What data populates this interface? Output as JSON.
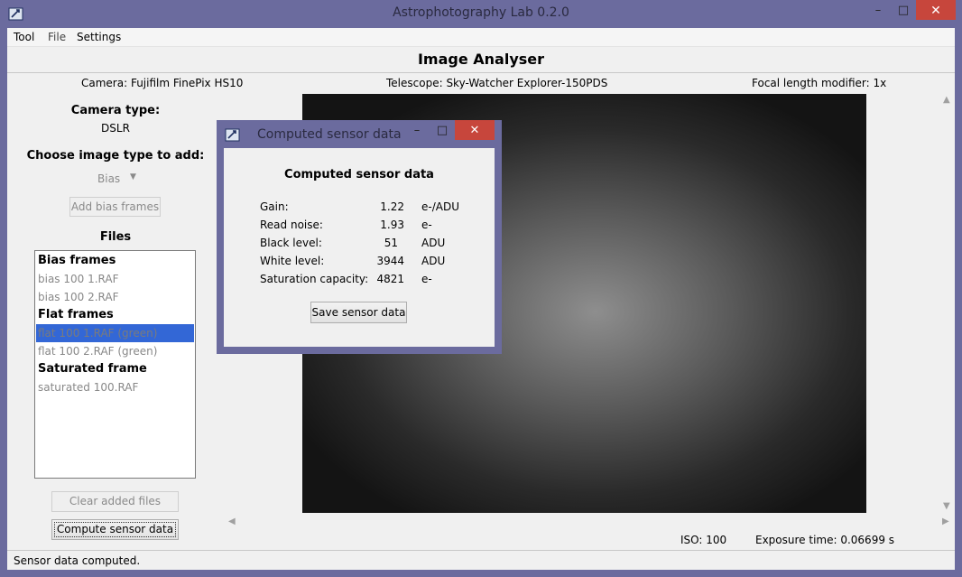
{
  "window": {
    "title": "Astrophotography Lab 0.2.0",
    "minimize": "–",
    "maximize": "□",
    "close": "✕"
  },
  "menu": [
    "Tool",
    "File",
    "Settings"
  ],
  "heading": "Image Analyser",
  "info": {
    "camera": "Camera: Fujifilm FinePix HS10",
    "telescope": "Telescope: Sky-Watcher Explorer-150PDS",
    "focal": "Focal length modifier: 1x"
  },
  "left": {
    "camera_type_label": "Camera type:",
    "camera_type_value": "DSLR",
    "choose_label": "Choose image type to add:",
    "image_type_selected": "Bias",
    "add_button": "Add bias frames",
    "files_label": "Files",
    "files": [
      {
        "text": "Bias frames",
        "kind": "header"
      },
      {
        "text": "bias 100 1.RAF",
        "kind": "item"
      },
      {
        "text": "bias 100 2.RAF",
        "kind": "item"
      },
      {
        "text": "Flat frames",
        "kind": "header"
      },
      {
        "text": "flat 100 1.RAF (green)",
        "kind": "selected"
      },
      {
        "text": "flat 100 2.RAF (green)",
        "kind": "item"
      },
      {
        "text": "Saturated frame",
        "kind": "header"
      },
      {
        "text": "saturated 100.RAF",
        "kind": "item"
      }
    ],
    "clear_button": "Clear added files",
    "compute_button": "Compute sensor data"
  },
  "image_footer": {
    "iso": "ISO: 100",
    "exposure": "Exposure time: 0.06699 s"
  },
  "status": "Sensor data computed.",
  "dialog": {
    "title": "Computed sensor data",
    "heading": "Computed sensor data",
    "rows": [
      {
        "label": "Gain:",
        "value": "1.22",
        "unit": "e-/ADU"
      },
      {
        "label": "Read noise:",
        "value": "1.93",
        "unit": "e-"
      },
      {
        "label": "Black level:",
        "value": "51",
        "unit": "ADU"
      },
      {
        "label": "White level:",
        "value": "3944",
        "unit": "ADU"
      },
      {
        "label": "Saturation capacity:",
        "value": "4821",
        "unit": "e-"
      }
    ],
    "save_button": "Save sensor data"
  },
  "colors": {
    "frame": "#6b6b9e",
    "close": "#c7463c",
    "selection": "#3367d6"
  }
}
